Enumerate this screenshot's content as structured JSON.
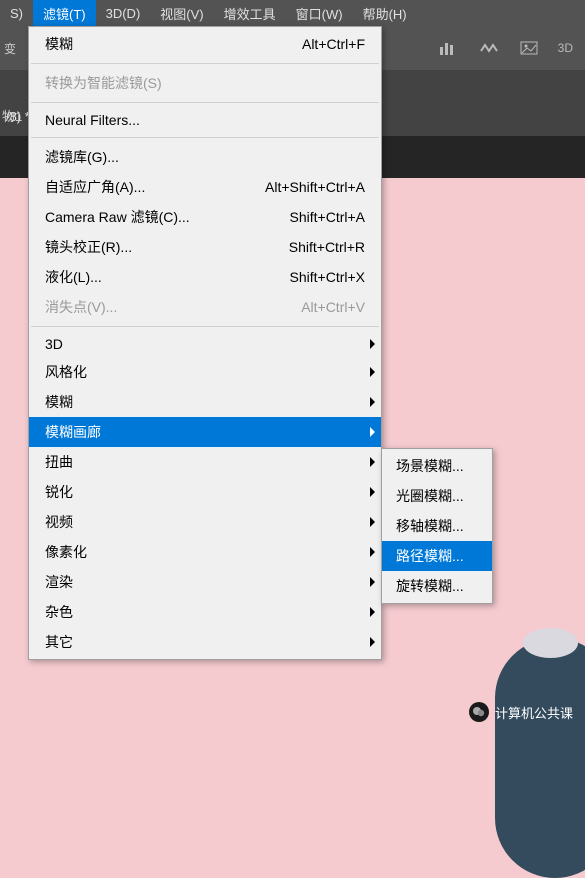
{
  "menubar": {
    "items": [
      {
        "label": "S)"
      },
      {
        "label": "滤镜(T)",
        "active": true
      },
      {
        "label": "3D(D)"
      },
      {
        "label": "视图(V)"
      },
      {
        "label": "增效工具"
      },
      {
        "label": "窗口(W)"
      },
      {
        "label": "帮助(H)"
      }
    ]
  },
  "toolbar": {
    "left_text": "变",
    "right_text": "3D"
  },
  "sidebar": {
    "text": "物1"
  },
  "doc_tab": {
    "label": "/8) *",
    "close": "×"
  },
  "dropdown": {
    "top": {
      "label": "模糊",
      "shortcut": "Alt+Ctrl+F"
    },
    "convert": {
      "label": "转换为智能滤镜(S)"
    },
    "neural": {
      "label": "Neural Filters..."
    },
    "group1": [
      {
        "label": "滤镜库(G)...",
        "shortcut": ""
      },
      {
        "label": "自适应广角(A)...",
        "shortcut": "Alt+Shift+Ctrl+A"
      },
      {
        "label": "Camera Raw 滤镜(C)...",
        "shortcut": "Shift+Ctrl+A"
      },
      {
        "label": "镜头校正(R)...",
        "shortcut": "Shift+Ctrl+R"
      },
      {
        "label": "液化(L)...",
        "shortcut": "Shift+Ctrl+X"
      },
      {
        "label": "消失点(V)...",
        "shortcut": "Alt+Ctrl+V",
        "disabled": true
      }
    ],
    "group2": [
      {
        "label": "3D",
        "arrow": true
      },
      {
        "label": "风格化",
        "arrow": true
      },
      {
        "label": "模糊",
        "arrow": true
      },
      {
        "label": "模糊画廊",
        "arrow": true,
        "highlight": true
      },
      {
        "label": "扭曲",
        "arrow": true
      },
      {
        "label": "锐化",
        "arrow": true
      },
      {
        "label": "视频",
        "arrow": true
      },
      {
        "label": "像素化",
        "arrow": true
      },
      {
        "label": "渲染",
        "arrow": true
      },
      {
        "label": "杂色",
        "arrow": true
      },
      {
        "label": "其它",
        "arrow": true
      }
    ]
  },
  "submenu": {
    "items": [
      {
        "label": "场景模糊..."
      },
      {
        "label": "光圈模糊..."
      },
      {
        "label": "移轴模糊..."
      },
      {
        "label": "路径模糊...",
        "highlight": true
      },
      {
        "label": "旋转模糊..."
      }
    ]
  },
  "watermark": {
    "text": "计算机公共课"
  }
}
